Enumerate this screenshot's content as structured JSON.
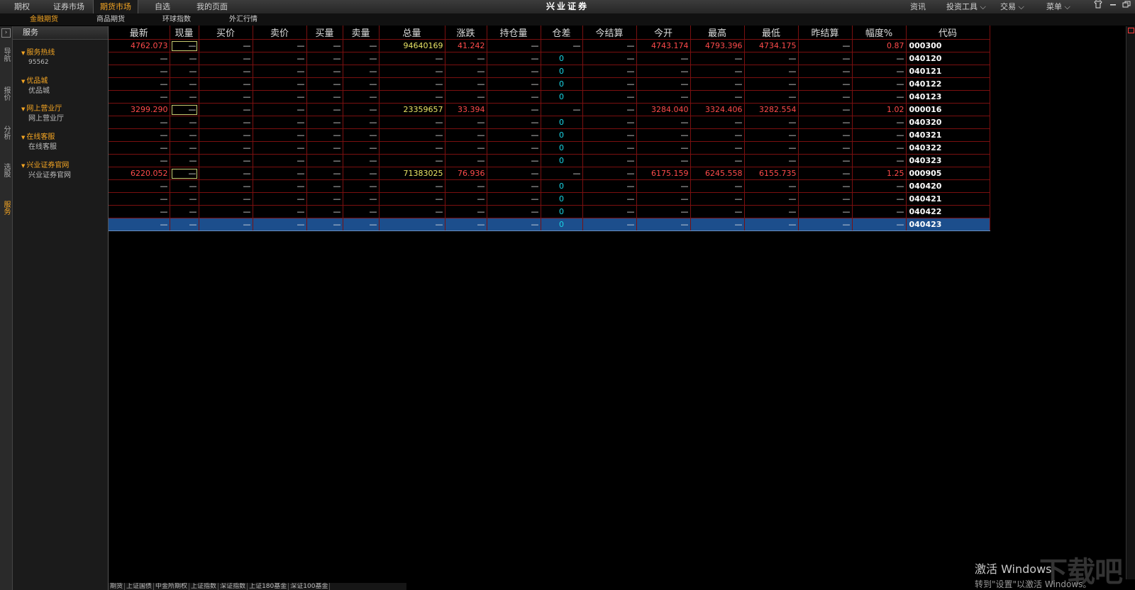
{
  "app": {
    "title": "兴业证券"
  },
  "top_tabs": [
    {
      "label": "期权",
      "active": false
    },
    {
      "label": "证券市场",
      "active": false
    },
    {
      "label": "期货市场",
      "active": true
    },
    {
      "label": "自选",
      "active": false
    },
    {
      "label": "我的页面",
      "active": false
    }
  ],
  "right_menus": [
    {
      "label": "资讯"
    },
    {
      "label": "投资工具 ⌵"
    },
    {
      "label": "交易 ⌵"
    },
    {
      "label": "菜单 ⌵"
    }
  ],
  "window_icons": [
    "shirt-icon",
    "minimize-icon",
    "restore-icon"
  ],
  "sub_tabs": [
    {
      "label": "金融期货",
      "active": true
    },
    {
      "label": "商品期货",
      "active": false
    },
    {
      "label": "环球指数",
      "active": false
    },
    {
      "label": "外汇行情",
      "active": false
    }
  ],
  "vertical_nav": [
    {
      "label": "导航",
      "active": false
    },
    {
      "label": "报价",
      "active": false
    },
    {
      "label": "分析",
      "active": false
    },
    {
      "label": "选股",
      "active": false
    },
    {
      "label": "服务",
      "active": true
    }
  ],
  "service_panel": {
    "title": "服务",
    "groups": [
      {
        "title": "服务热线",
        "sub": "95562"
      },
      {
        "title": "优品城",
        "sub": "优品城"
      },
      {
        "title": "网上营业厅",
        "sub": "网上营业厅"
      },
      {
        "title": "在线客服",
        "sub": "在线客服"
      },
      {
        "title": "兴业证券官网",
        "sub": "兴业证券官网"
      }
    ]
  },
  "table": {
    "columns": [
      "最新",
      "现量",
      "买价",
      "卖价",
      "买量",
      "卖量",
      "总量",
      "涨跌",
      "持仓量",
      "仓差",
      "今结算",
      "今开",
      "最高",
      "最低",
      "昨结算",
      "幅度%",
      "代码"
    ],
    "rows": [
      [
        "4762.073",
        "—",
        "—",
        "—",
        "—",
        "—",
        "94640169",
        "41.242",
        "—",
        "—",
        "—",
        "4743.174",
        "4793.396",
        "4734.175",
        "—",
        "0.87",
        "000300"
      ],
      [
        "—",
        "—",
        "—",
        "—",
        "—",
        "—",
        "—",
        "—",
        "—",
        "0",
        "—",
        "—",
        "—",
        "—",
        "—",
        "—",
        "040120"
      ],
      [
        "—",
        "—",
        "—",
        "—",
        "—",
        "—",
        "—",
        "—",
        "—",
        "0",
        "—",
        "—",
        "—",
        "—",
        "—",
        "—",
        "040121"
      ],
      [
        "—",
        "—",
        "—",
        "—",
        "—",
        "—",
        "—",
        "—",
        "—",
        "0",
        "—",
        "—",
        "—",
        "—",
        "—",
        "—",
        "040122"
      ],
      [
        "—",
        "—",
        "—",
        "—",
        "—",
        "—",
        "—",
        "—",
        "—",
        "0",
        "—",
        "—",
        "—",
        "—",
        "—",
        "—",
        "040123"
      ],
      [
        "3299.290",
        "—",
        "—",
        "—",
        "—",
        "—",
        "23359657",
        "33.394",
        "—",
        "—",
        "—",
        "3284.040",
        "3324.406",
        "3282.554",
        "—",
        "1.02",
        "000016"
      ],
      [
        "—",
        "—",
        "—",
        "—",
        "—",
        "—",
        "—",
        "—",
        "—",
        "0",
        "—",
        "—",
        "—",
        "—",
        "—",
        "—",
        "040320"
      ],
      [
        "—",
        "—",
        "—",
        "—",
        "—",
        "—",
        "—",
        "—",
        "—",
        "0",
        "—",
        "—",
        "—",
        "—",
        "—",
        "—",
        "040321"
      ],
      [
        "—",
        "—",
        "—",
        "—",
        "—",
        "—",
        "—",
        "—",
        "—",
        "0",
        "—",
        "—",
        "—",
        "—",
        "—",
        "—",
        "040322"
      ],
      [
        "—",
        "—",
        "—",
        "—",
        "—",
        "—",
        "—",
        "—",
        "—",
        "0",
        "—",
        "—",
        "—",
        "—",
        "—",
        "—",
        "040323"
      ],
      [
        "6220.052",
        "—",
        "—",
        "—",
        "—",
        "—",
        "71383025",
        "76.936",
        "—",
        "—",
        "—",
        "6175.159",
        "6245.558",
        "6155.735",
        "—",
        "1.25",
        "000905"
      ],
      [
        "—",
        "—",
        "—",
        "—",
        "—",
        "—",
        "—",
        "—",
        "—",
        "0",
        "—",
        "—",
        "—",
        "—",
        "—",
        "—",
        "040420"
      ],
      [
        "—",
        "—",
        "—",
        "—",
        "—",
        "—",
        "—",
        "—",
        "—",
        "0",
        "—",
        "—",
        "—",
        "—",
        "—",
        "—",
        "040421"
      ],
      [
        "—",
        "—",
        "—",
        "—",
        "—",
        "—",
        "—",
        "—",
        "—",
        "0",
        "—",
        "—",
        "—",
        "—",
        "—",
        "—",
        "040422"
      ],
      [
        "—",
        "—",
        "—",
        "—",
        "—",
        "—",
        "—",
        "—",
        "—",
        "0",
        "—",
        "—",
        "—",
        "—",
        "—",
        "—",
        "040423"
      ]
    ],
    "selected_row": 14
  },
  "bottom_tabs": [
    "期货",
    "上证国债",
    "中金所期权",
    "上证指数",
    "深证指数",
    "上证180基金",
    "深证100基金"
  ],
  "watermark": {
    "line1": "激活 Windows",
    "line2": "转到\"设置\"以激活 Windows。",
    "logo": "下载吧"
  },
  "colors": {
    "up": "#ff4b4b",
    "volume": "#e8e466",
    "zero": "#19d5e5",
    "accent": "#f5a623",
    "grid": "#7a1010",
    "selected": "#1c4e8c"
  }
}
